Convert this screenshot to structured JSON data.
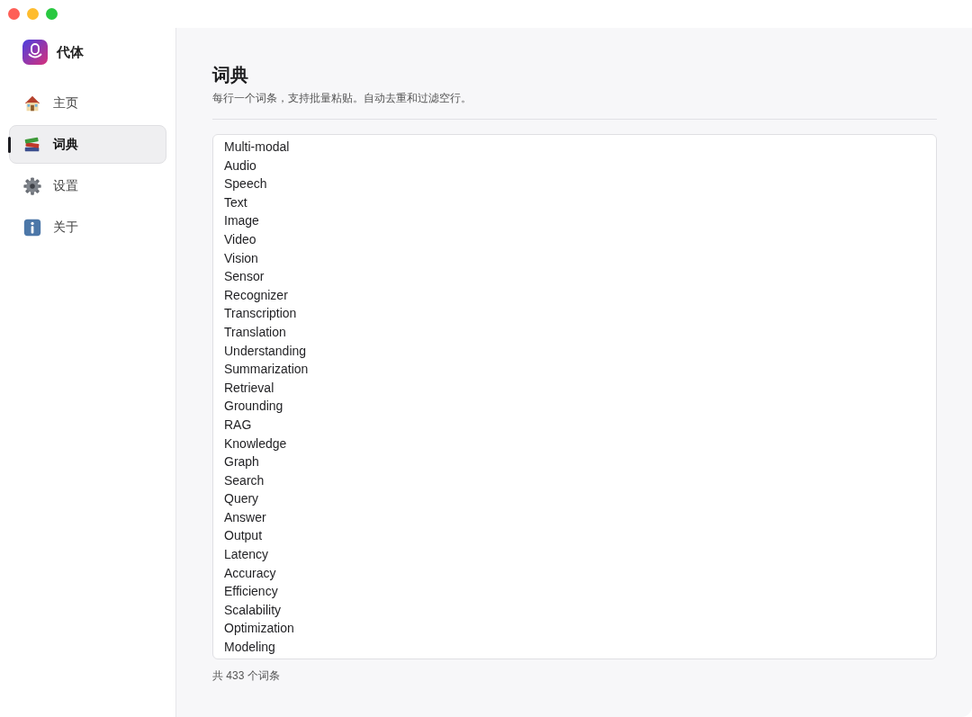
{
  "app": {
    "name": "代体"
  },
  "sidebar": {
    "items": [
      {
        "label": "主页",
        "kind": "house",
        "selected": false
      },
      {
        "label": "词典",
        "kind": "books",
        "selected": true
      },
      {
        "label": "设置",
        "kind": "gear",
        "selected": false
      },
      {
        "label": "关于",
        "kind": "info",
        "selected": false
      }
    ]
  },
  "page": {
    "title": "词典",
    "subtitle": "每行一个词条，支持批量粘贴。自动去重和过滤空行。"
  },
  "editor": {
    "lines": [
      "Multi-modal",
      "Audio",
      "Speech",
      "Text",
      "Image",
      "Video",
      "Vision",
      "Sensor",
      "Recognizer",
      "Transcription",
      "Translation",
      "Understanding",
      "Summarization",
      "Retrieval",
      "Grounding",
      "RAG",
      "Knowledge",
      "Graph",
      "Search",
      "Query",
      "Answer",
      "Output",
      "Latency",
      "Accuracy",
      "Efficiency",
      "Scalability",
      "Optimization",
      "Modeling"
    ]
  },
  "status": {
    "count": "共 433 个词条"
  }
}
